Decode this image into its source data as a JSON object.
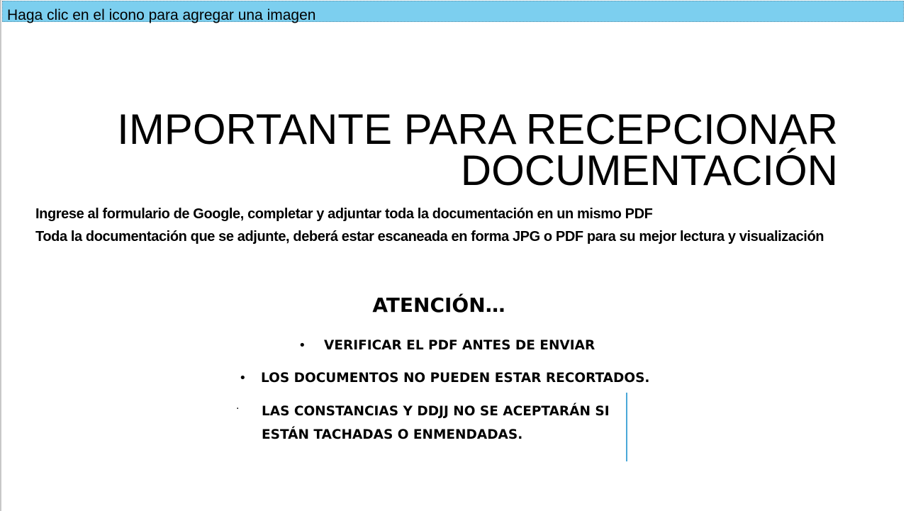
{
  "placeholder": {
    "text": "Haga clic en el icono para agregar una imagen"
  },
  "title": {
    "line1": "IMPORTANTE PARA RECEPCIONAR",
    "line2": "DOCUMENTACIÓN"
  },
  "instructions": [
    "Ingrese al formulario de Google, completar y adjuntar toda la documentación en un mismo PDF",
    "Toda la documentación que se adjunte, deberá estar escaneada en forma JPG o PDF para su mejor lectura y visualización"
  ],
  "attention": {
    "heading": "ATENCIÓN…",
    "items": [
      {
        "bullet": "•",
        "text": "VERIFICAR EL PDF ANTES DE ENVIAR"
      },
      {
        "bullet": "•",
        "text": "LOS DOCUMENTOS NO PUEDEN ESTAR RECORTADOS."
      },
      {
        "bullet": "·",
        "line1": "LAS CONSTANCIAS Y DDJJ NO SE ACEPTARÁN SI",
        "line2": "ESTÁN TACHADAS O ENMENDADAS."
      }
    ]
  },
  "colors": {
    "placeholder_bg": "#7ccfef",
    "cursor": "#4aa8d8",
    "text": "#000000"
  }
}
